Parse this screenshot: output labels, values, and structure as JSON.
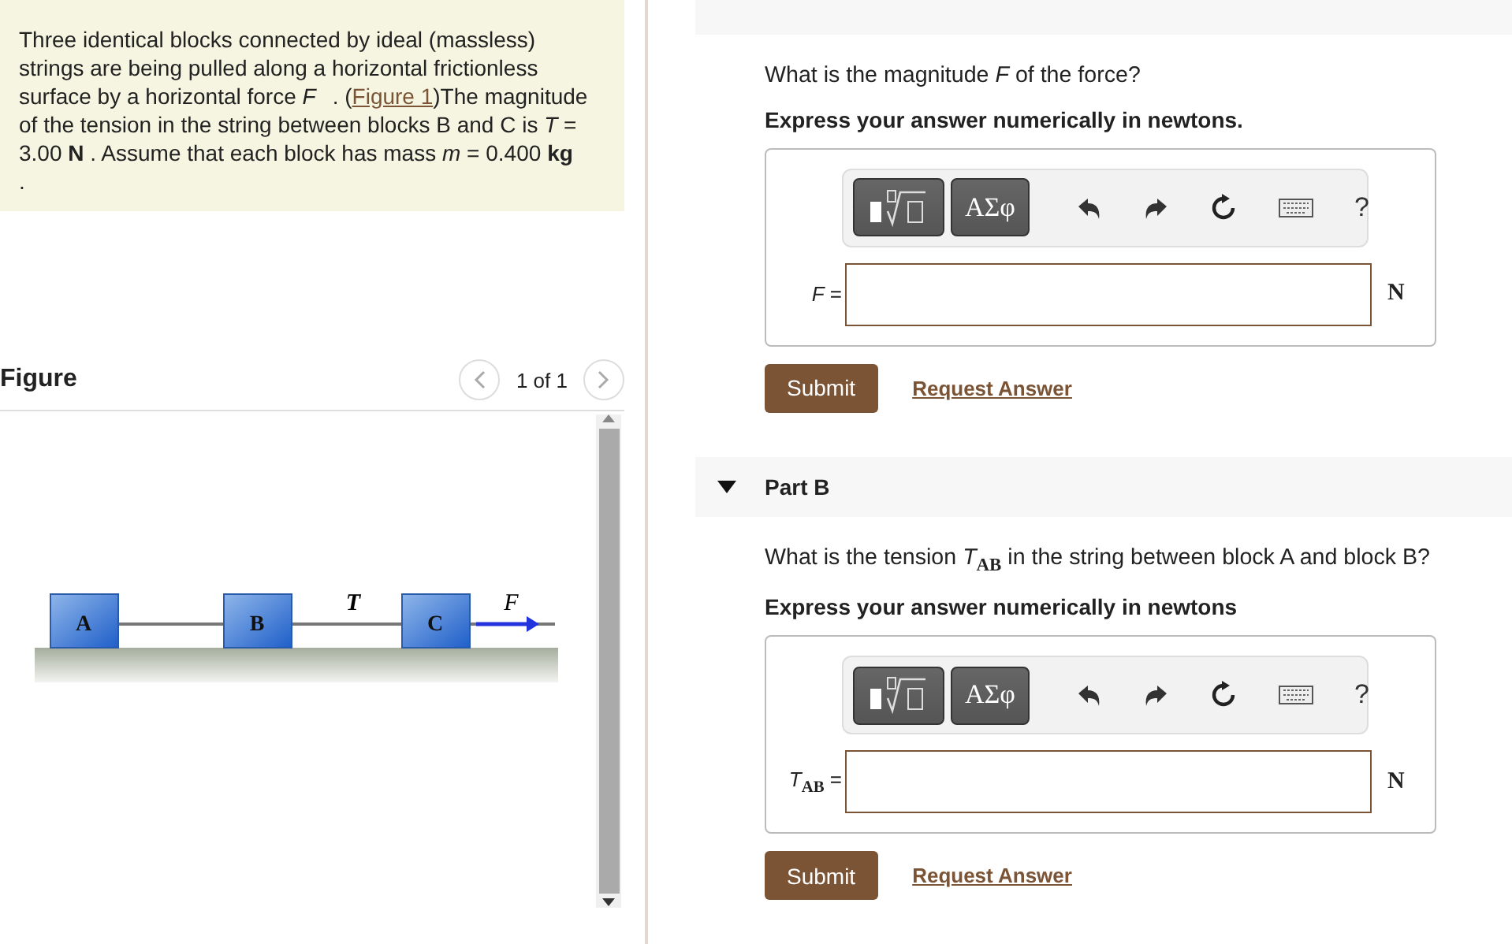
{
  "problem": {
    "before": "Three identical blocks connected by ideal (massless) strings are being pulled along a horizontal frictionless surface by a horizontal force *F⃗*. (",
    "link": "Figure 1",
    "after": ")The magnitude of the tension in the string between blocks B and C is *T* = 3.00 **N** . Assume that each block has mass *m* = 0.400 **kg**",
    "end": "."
  },
  "figure": {
    "title": "Figure",
    "pager": "1 of 1",
    "blocks": [
      "A",
      "B",
      "C"
    ],
    "tension_label": "T",
    "force_label": "F⃗"
  },
  "parts": [
    {
      "question": "What is the magnitude *F* of the force?",
      "instruction": "Express your answer numerically in newtons.",
      "symbols": "ΑΣφ",
      "help": "?",
      "variable": "*F* =",
      "unit": "N",
      "submit": "Submit",
      "link": "Request Answer"
    },
    {
      "title": "Part B",
      "expanded": true,
      "question": "What is the tension *T*$_{AB}$ in the string between block A and block B?",
      "instruction": "Express your answer numerically in newtons",
      "symbols": "ΑΣφ",
      "help": "?",
      "variable": "*T*$_{AB}$ =",
      "unit": "N",
      "submit": "Submit",
      "link": "Request Answer"
    }
  ]
}
